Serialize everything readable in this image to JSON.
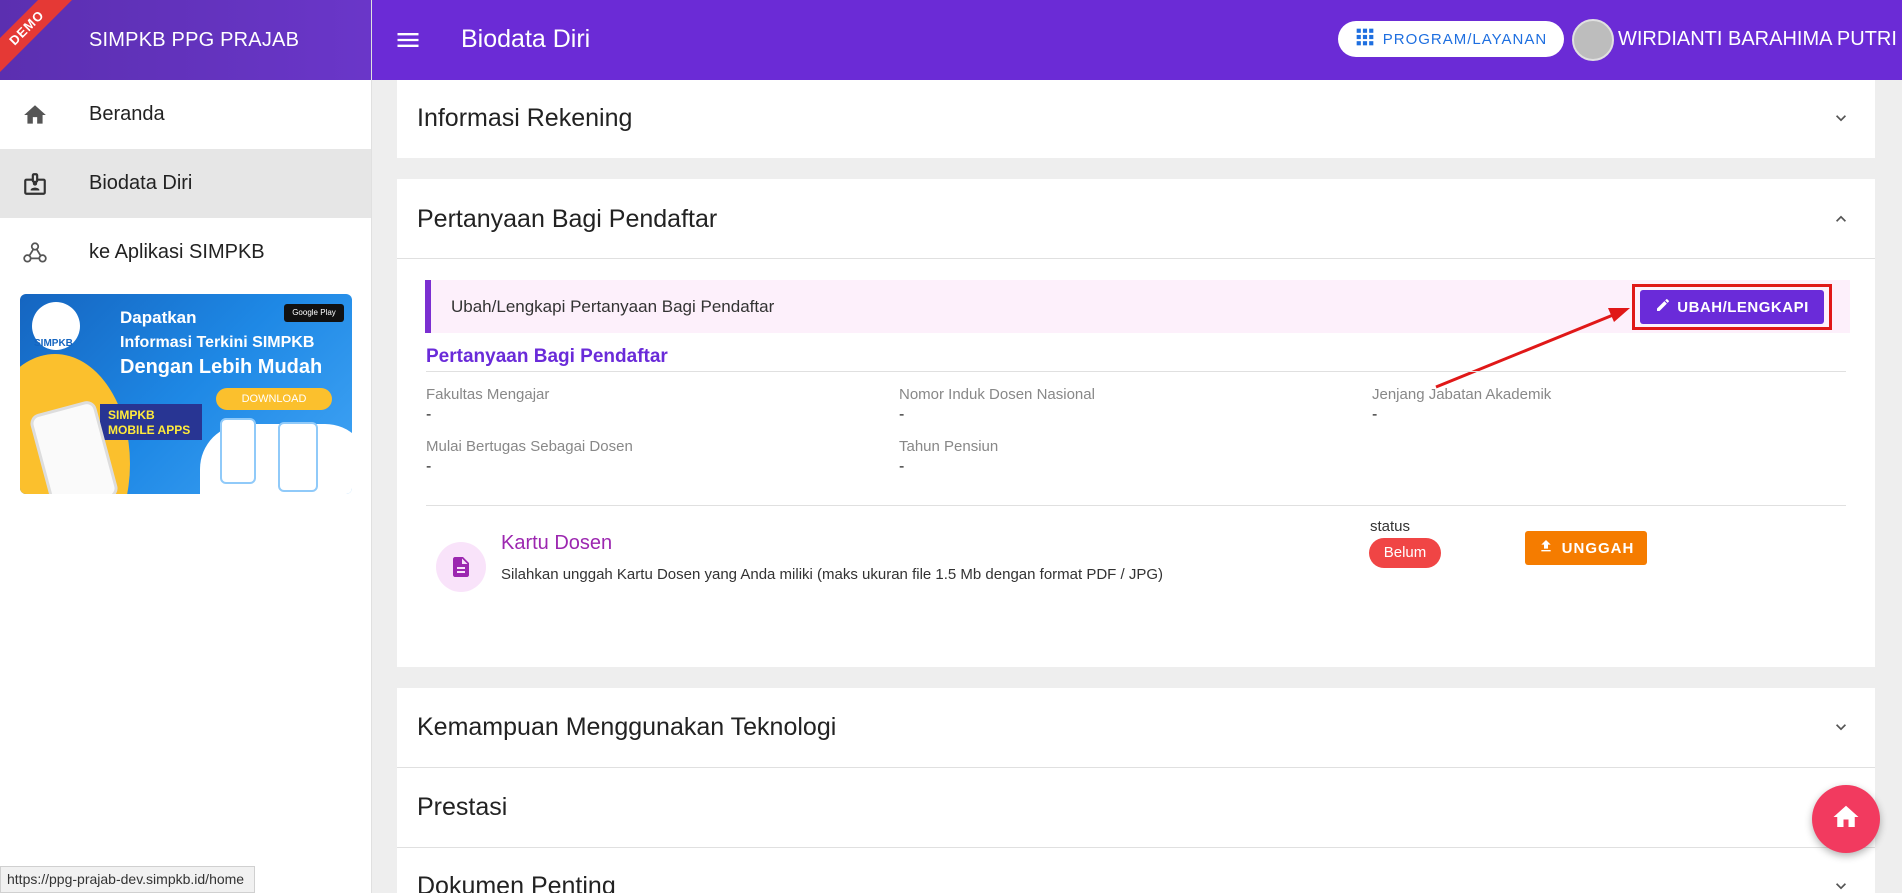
{
  "app": {
    "brand": "SIMPKB PPG PRAJAB",
    "demo_ribbon": "DEMO",
    "page_title": "Biodata Diri",
    "program_button": "PROGRAM/LAYANAN",
    "user_name": "WIRDIANTI BARAHIMA PUTRI"
  },
  "sidebar": {
    "items": [
      {
        "label": "Beranda",
        "icon": "home-icon"
      },
      {
        "label": "Biodata Diri",
        "icon": "badge-icon"
      },
      {
        "label": "ke Aplikasi SIMPKB",
        "icon": "webhook-icon"
      }
    ],
    "promo": {
      "logo": "SIMPKB",
      "headline": "Dapatkan",
      "line1": "Informasi Terkini SIMPKB",
      "line2": "Dengan Lebih Mudah",
      "store_badge": "Google Play",
      "download": "DOWNLOAD",
      "apps_label_1": "SIMPKB",
      "apps_label_2": "MOBILE APPS"
    }
  },
  "sections": {
    "rekening": {
      "title": "Informasi Rekening"
    },
    "pertanyaan": {
      "title": "Pertanyaan Bagi Pendaftar",
      "notice": "Ubah/Lengkapi Pertanyaan Bagi Pendaftar",
      "edit_button": "UBAH/LENGKAPI",
      "subtitle": "Pertanyaan Bagi Pendaftar",
      "fields": [
        {
          "label": "Fakultas Mengajar",
          "value": "-"
        },
        {
          "label": "Nomor Induk Dosen Nasional",
          "value": "-"
        },
        {
          "label": "Jenjang Jabatan Akademik",
          "value": "-"
        },
        {
          "label": "Mulai Bertugas Sebagai Dosen",
          "value": "-"
        },
        {
          "label": "Tahun Pensiun",
          "value": "-"
        }
      ],
      "document": {
        "title": "Kartu Dosen",
        "description": "Silahkan unggah Kartu Dosen yang Anda miliki (maks ukuran file 1.5 Mb dengan format PDF / JPG)",
        "status_label": "status",
        "status": "Belum",
        "upload_button": "UNGGAH"
      }
    },
    "teknologi": {
      "title": "Kemampuan Menggunakan Teknologi"
    },
    "prestasi": {
      "title": "Prestasi"
    },
    "dokumen": {
      "title": "Dokumen Penting"
    }
  },
  "browser_status_url": "https://ppg-prajab-dev.simpkb.id/home",
  "colors": {
    "primary": "#6b2bd6",
    "accent_red": "#e01818",
    "upload": "#f57c00",
    "fab": "#f23a5f"
  }
}
